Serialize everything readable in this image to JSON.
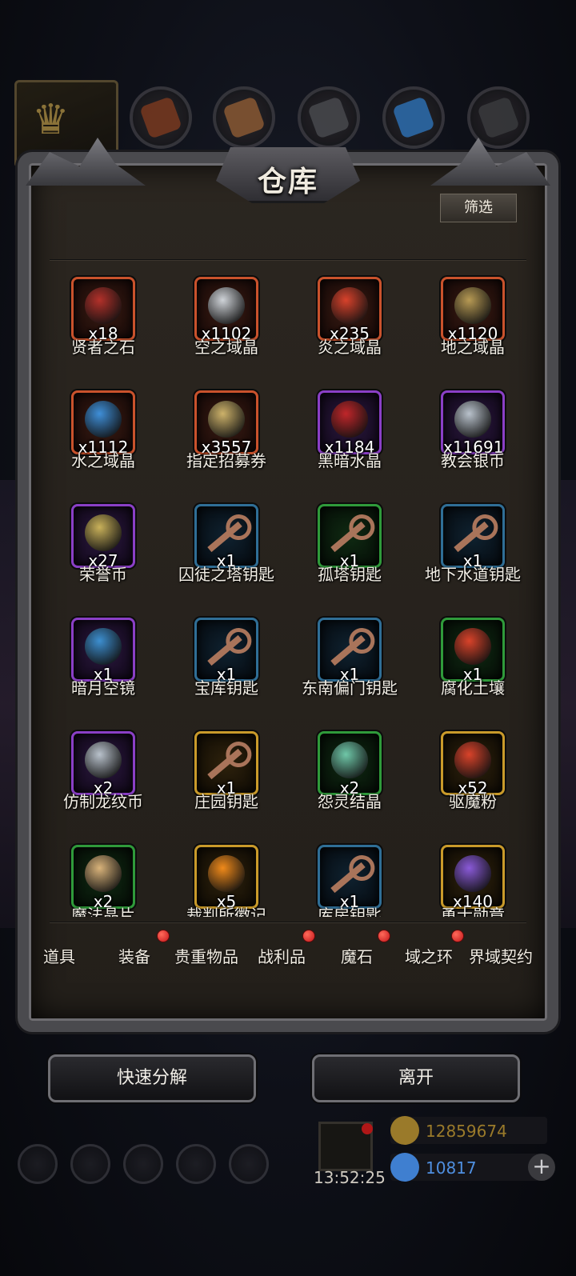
{
  "dialog": {
    "title": "仓库",
    "filter_label": "筛选"
  },
  "items": [
    {
      "name": "贤者之石",
      "qty": "x18",
      "rarity": "orange",
      "icon": "red-stone-icon",
      "color": "#b3312a"
    },
    {
      "name": "空之域晶",
      "qty": "x1102",
      "rarity": "orange",
      "icon": "white-crystal-icon",
      "color": "#cfd3d8"
    },
    {
      "name": "炎之域晶",
      "qty": "x235",
      "rarity": "orange",
      "icon": "fire-crystal-icon",
      "color": "#d8422b"
    },
    {
      "name": "地之域晶",
      "qty": "x1120",
      "rarity": "orange",
      "icon": "earth-crystal-icon",
      "color": "#b79a54"
    },
    {
      "name": "水之域晶",
      "qty": "x1112",
      "rarity": "orange",
      "icon": "water-crystal-icon",
      "color": "#3f8fd8"
    },
    {
      "name": "指定招募券",
      "qty": "x3557",
      "rarity": "orange",
      "icon": "scroll-icon",
      "color": "#cdb26a"
    },
    {
      "name": "黑暗水晶",
      "qty": "x1184",
      "rarity": "purple",
      "icon": "dark-crystal-icon",
      "color": "#c0262a"
    },
    {
      "name": "教会银币",
      "qty": "x11691",
      "rarity": "purple",
      "icon": "silver-coin-icon",
      "color": "#b9c2cc"
    },
    {
      "name": "荣誉币",
      "qty": "x27",
      "rarity": "purple",
      "icon": "gold-coin-icon",
      "color": "#c9b15a"
    },
    {
      "name": "囚徒之塔钥匙",
      "qty": "x1",
      "rarity": "blue",
      "icon": "key-icon",
      "color": "#a9745a"
    },
    {
      "name": "孤塔钥匙",
      "qty": "x1",
      "rarity": "green",
      "icon": "key-icon",
      "color": "#a9745a"
    },
    {
      "name": "地下水道钥匙",
      "qty": "x1",
      "rarity": "blue",
      "icon": "key-icon",
      "color": "#a9745a"
    },
    {
      "name": "暗月空镜",
      "qty": "x1",
      "rarity": "purple",
      "icon": "mirror-icon",
      "color": "#3d8fd0"
    },
    {
      "name": "宝库钥匙",
      "qty": "x1",
      "rarity": "blue",
      "icon": "key-icon",
      "color": "#a9745a"
    },
    {
      "name": "东南偏门钥匙",
      "qty": "x1",
      "rarity": "blue",
      "icon": "key-icon",
      "color": "#a9745a"
    },
    {
      "name": "腐化土壤",
      "qty": "x1",
      "rarity": "green",
      "icon": "soil-icon",
      "color": "#d9432a"
    },
    {
      "name": "仿制龙纹币",
      "qty": "x2",
      "rarity": "purple",
      "icon": "silver-coin-icon",
      "color": "#b9c2cc"
    },
    {
      "name": "庄园钥匙",
      "qty": "x1",
      "rarity": "gold",
      "icon": "key-icon",
      "color": "#a9745a"
    },
    {
      "name": "怨灵结晶",
      "qty": "x2",
      "rarity": "green",
      "icon": "spirit-crystal-icon",
      "color": "#6fc7a8"
    },
    {
      "name": "驱魔粉",
      "qty": "x52",
      "rarity": "gold",
      "icon": "powder-icon",
      "color": "#d9432a"
    },
    {
      "name": "魔法晶片",
      "qty": "x2",
      "rarity": "green",
      "icon": "hand-icon",
      "color": "#d9b37a"
    },
    {
      "name": "裁判所徽记",
      "qty": "x5",
      "rarity": "gold",
      "icon": "emblem-icon",
      "color": "#f08a1a"
    },
    {
      "name": "库房钥匙",
      "qty": "x1",
      "rarity": "blue",
      "icon": "key-icon",
      "color": "#a9745a"
    },
    {
      "name": "勇士勋章",
      "qty": "x140",
      "rarity": "gold",
      "icon": "medal-icon",
      "color": "#8a5ad8"
    }
  ],
  "tabs": [
    {
      "label": "道具",
      "badge": false
    },
    {
      "label": "装备",
      "badge": true
    },
    {
      "label": "贵重物品",
      "badge": false
    },
    {
      "label": "战利品",
      "badge": true
    },
    {
      "label": "魔石",
      "badge": true
    },
    {
      "label": "域之环",
      "badge": true
    },
    {
      "label": "界域契约",
      "badge": false
    }
  ],
  "buttons": {
    "decompose": "快速分解",
    "leave": "离开"
  },
  "hud": {
    "timer": "13:52:25",
    "gold": "12859674",
    "gems": "10817",
    "gold_color": "#9a7a2a",
    "gem_color": "#3f7fd0"
  }
}
